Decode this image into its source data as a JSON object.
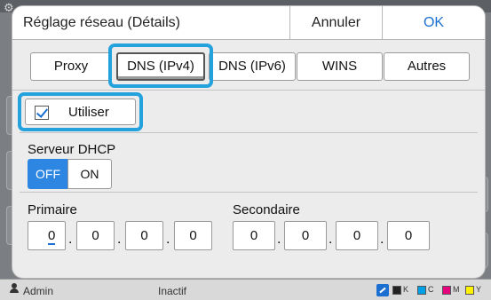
{
  "dialog": {
    "title": "Réglage réseau (Détails)",
    "cancel_label": "Annuler",
    "ok_label": "OK"
  },
  "tabs": [
    {
      "label": "Proxy",
      "active": false
    },
    {
      "label": "DNS (IPv4)",
      "active": true
    },
    {
      "label": "DNS (IPv6)",
      "active": false
    },
    {
      "label": "WINS",
      "active": false
    },
    {
      "label": "Autres",
      "active": false
    }
  ],
  "use_checkbox": {
    "label": "Utiliser",
    "checked": true
  },
  "dhcp": {
    "label": "Serveur DHCP",
    "off_label": "OFF",
    "on_label": "ON",
    "selected": "OFF"
  },
  "primary": {
    "label": "Primaire",
    "octets": [
      "0",
      "0",
      "0",
      "0"
    ]
  },
  "secondary": {
    "label": "Secondaire",
    "octets": [
      "0",
      "0",
      "0",
      "0"
    ]
  },
  "status_bar": {
    "user": "Admin",
    "state": "Inactif",
    "ink_labels": [
      "K",
      "C",
      "M",
      "Y"
    ]
  },
  "colors": {
    "accent": "#1b6fd1",
    "highlight": "#23a2dd",
    "selected_segment": "#2d87e2"
  }
}
